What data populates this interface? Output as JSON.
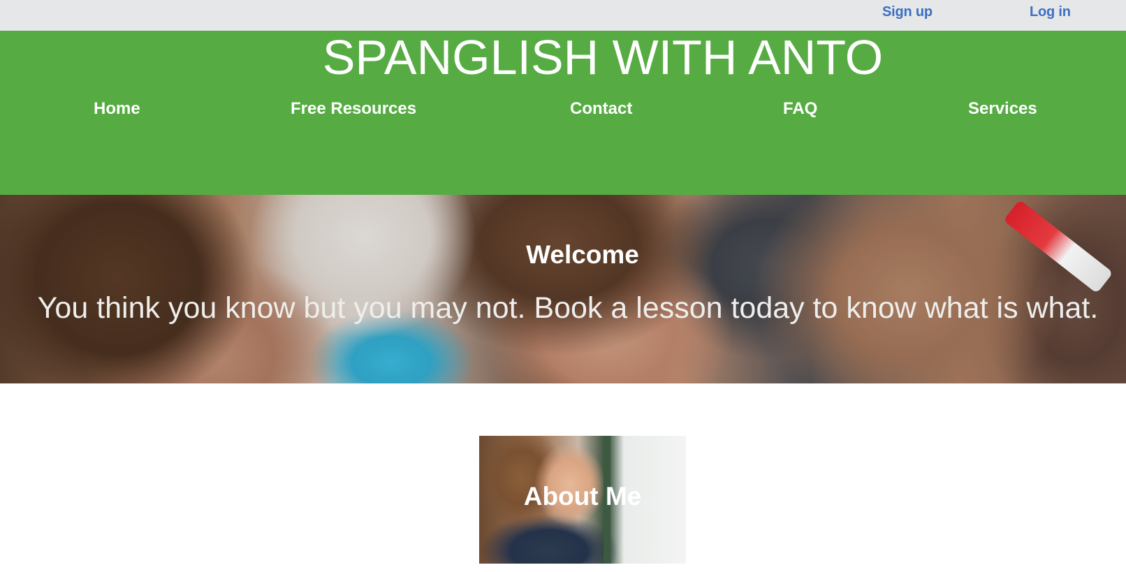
{
  "auth": {
    "signup_label": "Sign up",
    "login_label": "Log in"
  },
  "header": {
    "site_title": "SPANGLISH WITH ANTO",
    "background_color": "#56ac43",
    "nav": [
      {
        "label": "Home"
      },
      {
        "label": "Free Resources"
      },
      {
        "label": "Contact"
      },
      {
        "label": "FAQ"
      },
      {
        "label": "Services"
      }
    ]
  },
  "hero": {
    "heading": "Welcome",
    "tagline": "You think you know but you may not. Book a lesson today to know what is what."
  },
  "about": {
    "title": "About Me"
  },
  "colors": {
    "link_blue": "#3a6fc4",
    "topbar_gray": "#e6e7e9"
  }
}
